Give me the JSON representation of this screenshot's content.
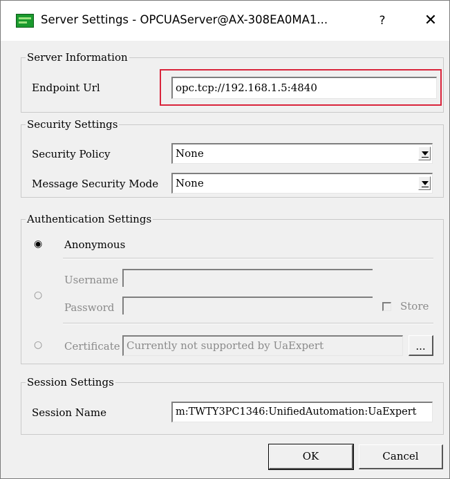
{
  "window": {
    "title": "Server Settings - OPCUAServer@AX-308EA0MA1...",
    "help_glyph": "?",
    "close_glyph": "✕"
  },
  "server_information": {
    "group_title": "Server Information",
    "endpoint_url_label": "Endpoint Url",
    "endpoint_url_value": "opc.tcp://192.168.1.5:4840"
  },
  "security_settings": {
    "group_title": "Security Settings",
    "security_policy_label": "Security Policy",
    "security_policy_value": "None",
    "message_security_mode_label": "Message Security Mode",
    "message_security_mode_value": "None"
  },
  "authentication_settings": {
    "group_title": "Authentication Settings",
    "anonymous_label": "Anonymous",
    "anonymous_selected": true,
    "username_label": "Username",
    "username_value": "",
    "password_label": "Password",
    "password_value": "",
    "store_label": "Store",
    "store_checked": false,
    "certificate_label": "Certificate",
    "certificate_value": "Currently not supported by UaExpert",
    "certificate_browse_label": "..."
  },
  "session_settings": {
    "group_title": "Session Settings",
    "session_name_label": "Session Name",
    "session_name_value": "m:TWTY3PC1346:UnifiedAutomation:UaExpert"
  },
  "buttons": {
    "ok_label": "OK",
    "cancel_label": "Cancel"
  },
  "colors": {
    "highlight": "#d9233a",
    "app_icon": "#1a9a2e"
  }
}
